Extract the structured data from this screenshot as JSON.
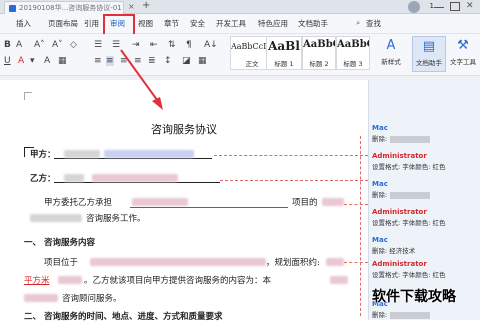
{
  "titlebar": {
    "tab_title": "20190108华...咨询服务协议-01",
    "close": "×",
    "add": "+",
    "window_badge": "1"
  },
  "menu": {
    "items": [
      "插入",
      "页面布局",
      "引用",
      "审阅",
      "视图",
      "章节",
      "安全",
      "开发工具",
      "特色应用",
      "文档助手"
    ],
    "active_index": 3,
    "search": "查找"
  },
  "toolbar": {
    "styles": [
      {
        "sample": "AaBbCcDd",
        "label": "正文"
      },
      {
        "sample": "AaBl",
        "label": "标题 1"
      },
      {
        "sample": "AaBbC",
        "label": "标题 2"
      },
      {
        "sample": "AaBbC",
        "label": "标题 3"
      }
    ],
    "new_style": "新样式",
    "doc_assist": "文档助手",
    "text_tools": "文字工具",
    "icons": [
      "bold-icon",
      "font-size-icon",
      "bullets-icon",
      "numbering-icon",
      "align-center-icon",
      "align-left-icon"
    ]
  },
  "document": {
    "title": "咨询服务协议",
    "party_a": "甲方：",
    "party_b": "乙方：",
    "para1_start": "甲方委托乙方承担",
    "para1_mid": "项目的",
    "para1_end": "咨询服务工作。",
    "section1": "一、 咨询服务内容",
    "para2_start": "项目位于",
    "para2_mid": "，规划面积约:",
    "para2_unit": "平方米",
    "para2_rest": "。乙方就该项目向甲方提供咨询服务的内容为：本",
    "para2_end": "咨询顾问服务。",
    "section2": "二、 咨询服务的时间、地点、进度、方式和质量要求"
  },
  "comments": [
    {
      "author": "Mac",
      "body": "删除:"
    },
    {
      "author": "Administrator",
      "body": "设置格式: 字体颜色: 红色"
    },
    {
      "author": "Mac",
      "body": "删除:"
    },
    {
      "author": "Administrator",
      "body": "设置格式: 字体颜色: 红色"
    },
    {
      "author": "Mac",
      "body": "删除: 经济技术"
    },
    {
      "author": "Administrator",
      "body": "设置格式: 字体颜色: 红色"
    },
    {
      "author": "Mac",
      "body": "删除:"
    }
  ],
  "watermark": "软件下载攻略",
  "colors": {
    "accent": "#2b6bd9",
    "highlight_red": "#e0303a",
    "comment_admin": "#d8262c",
    "comment_mac": "#2b6bd9"
  }
}
